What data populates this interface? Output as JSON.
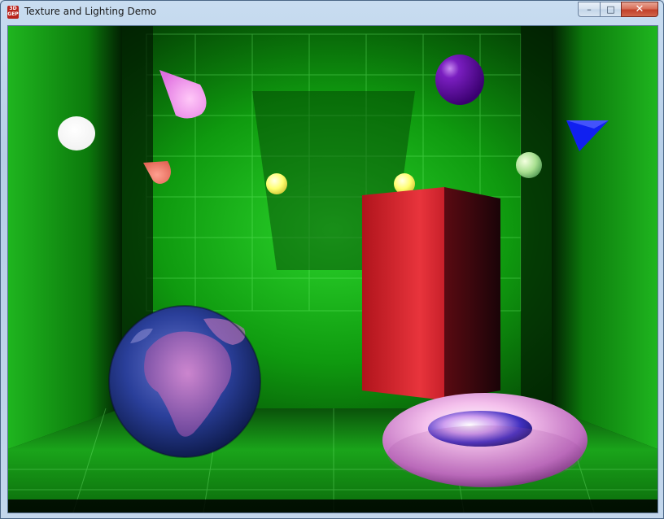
{
  "window": {
    "title": "Texture and Lighting Demo",
    "icon_text": "3D\nGEP",
    "minimize_glyph": "–",
    "maximize_glyph": "□",
    "close_glyph": "✕"
  },
  "scene": {
    "background_color": "#0a7a0a",
    "objects": [
      {
        "name": "white-sphere",
        "color": "#ffffff"
      },
      {
        "name": "pink-cone",
        "color": "#f08ce8"
      },
      {
        "name": "salmon-cone",
        "color": "#f07a6a"
      },
      {
        "name": "yellow-sphere-left",
        "color": "#ffff7a"
      },
      {
        "name": "yellow-sphere-right",
        "color": "#ffff9a"
      },
      {
        "name": "purple-sphere",
        "color": "#6a0aa0"
      },
      {
        "name": "green-sphere",
        "color": "#bff0a0"
      },
      {
        "name": "blue-cone",
        "color": "#1020f0"
      },
      {
        "name": "red-box",
        "color": "#c41a22"
      },
      {
        "name": "earth-sphere",
        "color": "#2a4a9a"
      },
      {
        "name": "pink-torus",
        "color": "#f0b0e8"
      }
    ]
  }
}
